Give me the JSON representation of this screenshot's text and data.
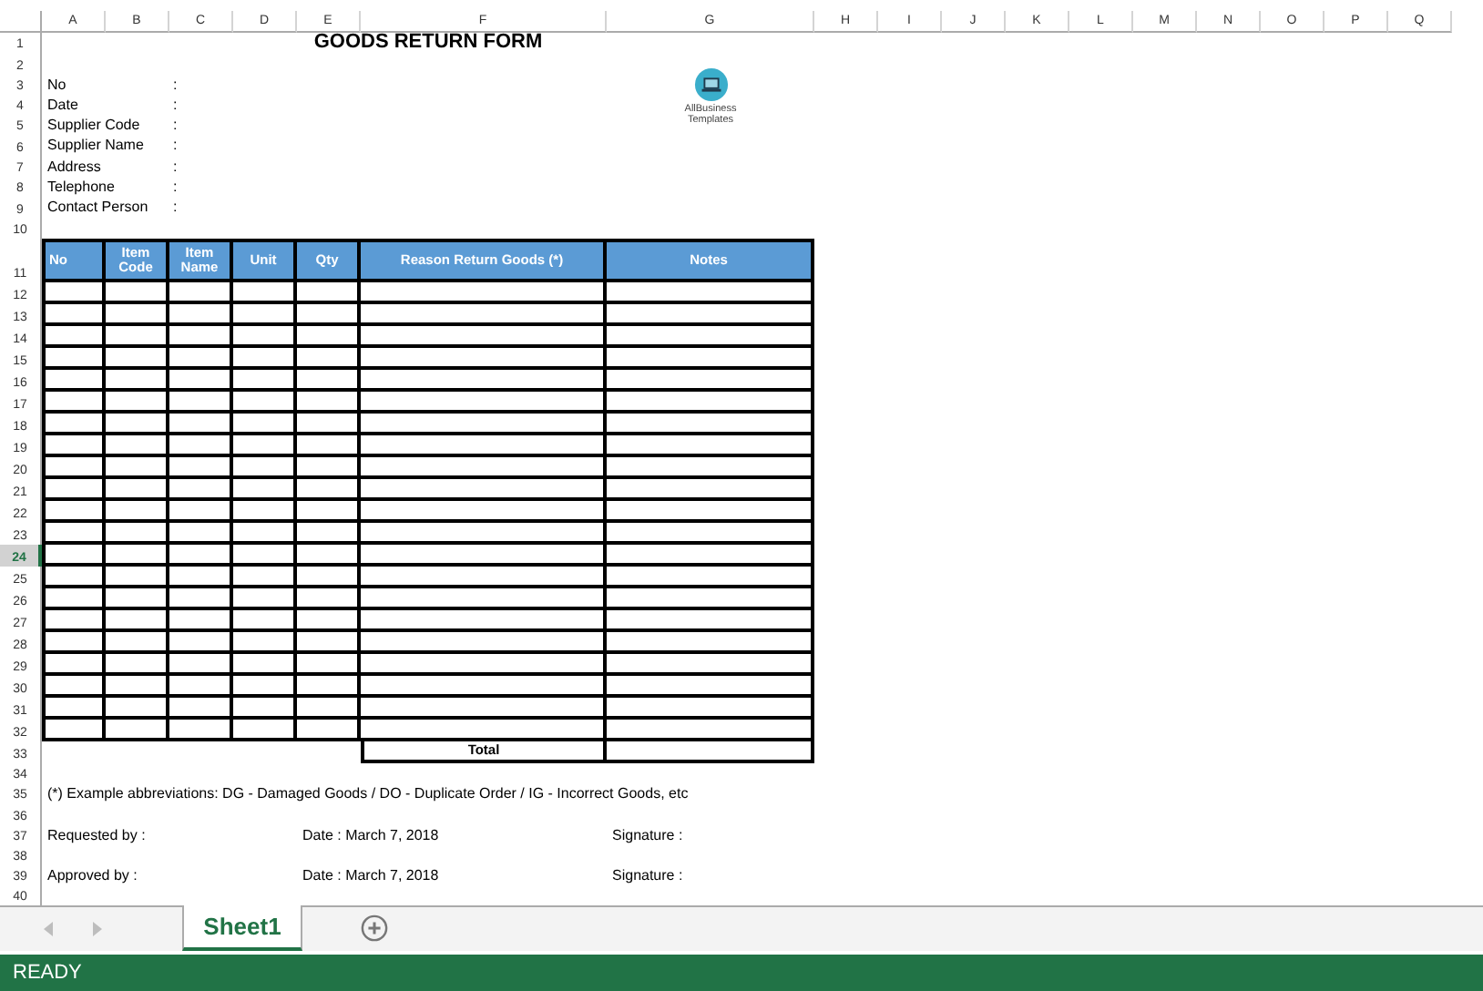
{
  "column_headers": [
    "A",
    "B",
    "C",
    "D",
    "E",
    "F",
    "G",
    "H",
    "I",
    "J",
    "K",
    "L",
    "M",
    "N",
    "O",
    "P",
    "Q"
  ],
  "row_headers": [
    {
      "label": "1",
      "selected": false
    },
    {
      "label": "2",
      "selected": false
    },
    {
      "label": "3",
      "selected": false
    },
    {
      "label": "4",
      "selected": false
    },
    {
      "label": "5",
      "selected": false
    },
    {
      "label": "6",
      "selected": false
    },
    {
      "label": "7",
      "selected": false
    },
    {
      "label": "8",
      "selected": false
    },
    {
      "label": "9",
      "selected": false
    },
    {
      "label": "10",
      "selected": false
    },
    {
      "label": "11",
      "selected": false
    },
    {
      "label": "12",
      "selected": false
    },
    {
      "label": "13",
      "selected": false
    },
    {
      "label": "14",
      "selected": false
    },
    {
      "label": "15",
      "selected": false
    },
    {
      "label": "16",
      "selected": false
    },
    {
      "label": "17",
      "selected": false
    },
    {
      "label": "18",
      "selected": false
    },
    {
      "label": "19",
      "selected": false
    },
    {
      "label": "20",
      "selected": false
    },
    {
      "label": "21",
      "selected": false
    },
    {
      "label": "22",
      "selected": false
    },
    {
      "label": "23",
      "selected": false
    },
    {
      "label": "24",
      "selected": true
    },
    {
      "label": "25",
      "selected": false
    },
    {
      "label": "26",
      "selected": false
    },
    {
      "label": "27",
      "selected": false
    },
    {
      "label": "28",
      "selected": false
    },
    {
      "label": "29",
      "selected": false
    },
    {
      "label": "30",
      "selected": false
    },
    {
      "label": "31",
      "selected": false
    },
    {
      "label": "32",
      "selected": false
    },
    {
      "label": "33",
      "selected": false
    },
    {
      "label": "34",
      "selected": false
    },
    {
      "label": "35",
      "selected": false
    },
    {
      "label": "36",
      "selected": false
    },
    {
      "label": "37",
      "selected": false
    },
    {
      "label": "38",
      "selected": false
    },
    {
      "label": "39",
      "selected": false
    },
    {
      "label": "40",
      "selected": false
    }
  ],
  "title": "GOODS RETURN FORM",
  "logo": {
    "line_1": "AllBusiness",
    "line_2": "Templates"
  },
  "fields": [
    {
      "label": "No",
      "separator": ":"
    },
    {
      "label": "Date",
      "separator": ":"
    },
    {
      "label": "Supplier Code",
      "separator": ":"
    },
    {
      "label": "Supplier Name",
      "separator": ":"
    },
    {
      "label": "Address",
      "separator": ":"
    },
    {
      "label": "Telephone",
      "separator": ":"
    },
    {
      "label": "Contact Person",
      "separator": ":"
    }
  ],
  "table": {
    "columns": [
      "No",
      "Item Code",
      "Item Name",
      "Unit",
      "Qty",
      "Reason Return Goods (*)",
      "Notes"
    ],
    "total_label": "Total"
  },
  "footnote": "(*) Example abbreviations: DG - Damaged Goods / DO - Duplicate Order / IG - Incorrect Goods, etc",
  "signatures": [
    {
      "label": "Requested by :",
      "date": "Date : March 7, 2018",
      "signature": "Signature :"
    },
    {
      "label": "Approved by :",
      "date": "Date : March 7, 2018",
      "signature": "Signature :"
    }
  ],
  "sheet_tabs": [
    {
      "label": "Sheet1",
      "selected": true
    }
  ],
  "status": "READY"
}
